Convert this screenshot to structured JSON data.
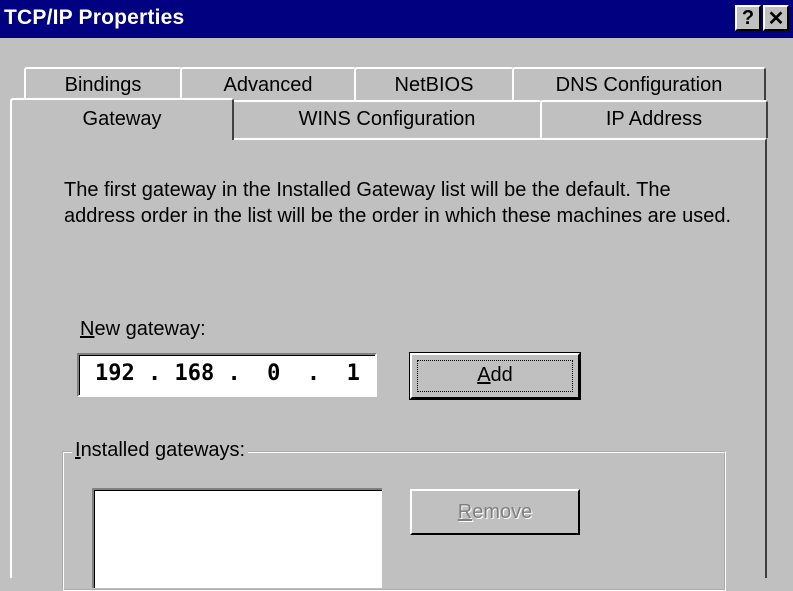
{
  "window": {
    "title": "TCP/IP Properties",
    "help_label": "?",
    "close_label": "✕"
  },
  "tabs": {
    "back_row": [
      "Bindings",
      "Advanced",
      "NetBIOS",
      "DNS Configuration"
    ],
    "front_row": [
      "Gateway",
      "WINS Configuration",
      "IP Address"
    ],
    "active": "Gateway"
  },
  "gateway": {
    "description": "The first gateway in the Installed Gateway list will be the default. The address order in the list will be the order in which these machines are used.",
    "new_gateway_label_mnemonic": "N",
    "new_gateway_label_rest": "ew gateway:",
    "ip_value": "192 . 168 .  0  .  1",
    "add_label_mnemonic": "A",
    "add_label_rest": "dd",
    "installed_label_mnemonic": "I",
    "installed_label_rest": "nstalled gateways:",
    "installed_items": [],
    "remove_label_mnemonic": "R",
    "remove_label_rest": "emove"
  },
  "colors": {
    "titlebar": "#000080",
    "face": "#c0c0c0"
  }
}
